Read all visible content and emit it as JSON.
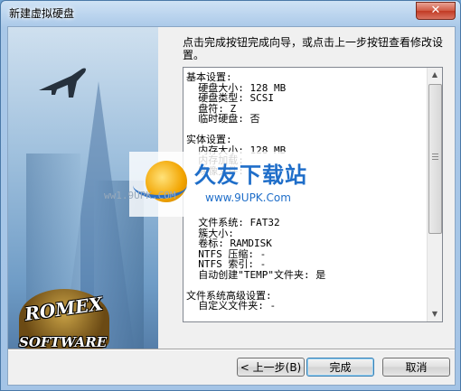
{
  "window": {
    "title": "新建虚拟硬盘",
    "close_glyph": "✕"
  },
  "instruction": "点击完成按钮完成向导，或点击上一步按钮查看修改设置。",
  "summary": {
    "lines": [
      "基本设置:",
      "  硬盘大小: 128 MB",
      "  硬盘类型: SCSI",
      "  盘符: Z",
      "  临时硬盘: 否",
      "",
      "实体设置:",
      "  内存大小: 128 MB",
      "  内存加载:",
      "  映像文件:",
      "",
      "",
      "",
      "",
      "  文件系统: FAT32",
      "  簇大小:",
      "  卷标: RAMDISK",
      "  NTFS 压缩: -",
      "  NTFS 索引: -",
      "  自动创建\"TEMP\"文件夹: 是",
      "",
      "文件系统高级设置:",
      "  自定义文件夹: -"
    ]
  },
  "buttons": {
    "back": "< 上一步(B)",
    "finish": "完成",
    "cancel": "取消"
  },
  "logo": {
    "line1": "ROMEX",
    "line2": "SOFTWARE"
  },
  "watermark": {
    "cn": "久友下载站",
    "url": "www.9UPK.Com",
    "side": "ww1.9UPK.COM"
  },
  "colors": {
    "title_bar": "#a9c8e8",
    "close_button": "#c23a24",
    "finish_border": "#3c7fb1"
  }
}
